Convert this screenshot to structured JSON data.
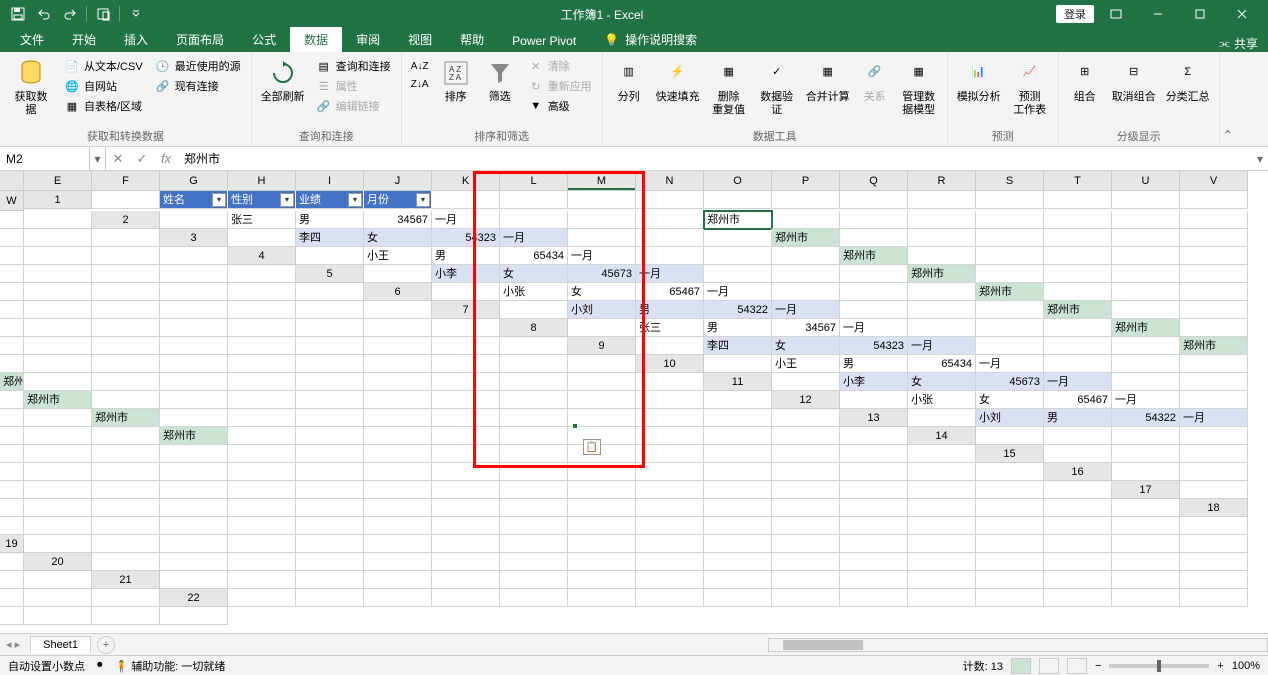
{
  "app": {
    "title": "工作簿1 - Excel",
    "login": "登录"
  },
  "tabs": [
    "文件",
    "开始",
    "插入",
    "页面布局",
    "公式",
    "数据",
    "审阅",
    "视图",
    "帮助",
    "Power Pivot"
  ],
  "active_tab": "数据",
  "tell_me": "操作说明搜索",
  "share": "共享",
  "ribbon": {
    "g1": {
      "label": "获取和转换数据",
      "big": "获取数\n据",
      "items": [
        "从文本/CSV",
        "自网站",
        "自表格/区域",
        "最近使用的源",
        "现有连接"
      ]
    },
    "g2": {
      "label": "查询和连接",
      "big": "全部刷新",
      "items": [
        "查询和连接",
        "属性",
        "编辑链接"
      ]
    },
    "g3": {
      "label": "排序和筛选",
      "sort": "排序",
      "filter": "筛选",
      "items": [
        "清除",
        "重新应用",
        "高级"
      ]
    },
    "g4": {
      "label": "数据工具",
      "items": [
        "分列",
        "快速填充",
        "删除\n重复值",
        "数据验\n证",
        "合并计算",
        "关系",
        "管理数\n据模型"
      ]
    },
    "g5": {
      "label": "预测",
      "items": [
        "模拟分析",
        "预测\n工作表"
      ]
    },
    "g6": {
      "label": "分级显示",
      "items": [
        "组合",
        "取消组合",
        "分类汇总"
      ]
    }
  },
  "name_box": "M2",
  "formula": "郑州市",
  "columns": [
    "E",
    "F",
    "G",
    "H",
    "I",
    "J",
    "K",
    "L",
    "M",
    "N",
    "O",
    "P",
    "Q",
    "R",
    "S",
    "T",
    "U",
    "V",
    "W"
  ],
  "headers": [
    "姓名",
    "性别",
    "业绩",
    "月份"
  ],
  "rows": [
    {
      "n": "张三",
      "s": "男",
      "v": "34567",
      "m": "一月"
    },
    {
      "n": "李四",
      "s": "女",
      "v": "54323",
      "m": "一月"
    },
    {
      "n": "小王",
      "s": "男",
      "v": "65434",
      "m": "一月"
    },
    {
      "n": "小李",
      "s": "女",
      "v": "45673",
      "m": "一月"
    },
    {
      "n": "小张",
      "s": "女",
      "v": "65467",
      "m": "一月"
    },
    {
      "n": "小刘",
      "s": "男",
      "v": "54322",
      "m": "一月"
    },
    {
      "n": "张三",
      "s": "男",
      "v": "34567",
      "m": "一月"
    },
    {
      "n": "李四",
      "s": "女",
      "v": "54323",
      "m": "一月"
    },
    {
      "n": "小王",
      "s": "男",
      "v": "65434",
      "m": "一月"
    },
    {
      "n": "小李",
      "s": "女",
      "v": "45673",
      "m": "一月"
    },
    {
      "n": "小张",
      "s": "女",
      "v": "65467",
      "m": "一月"
    },
    {
      "n": "小刘",
      "s": "男",
      "v": "54322",
      "m": "一月"
    }
  ],
  "m_value": "郑州市",
  "sheet": "Sheet1",
  "status": {
    "auto_decimal": "自动设置小数点",
    "a11y": "辅助功能: 一切就绪",
    "count_label": "计数:",
    "count": "13",
    "zoom": "100%"
  }
}
